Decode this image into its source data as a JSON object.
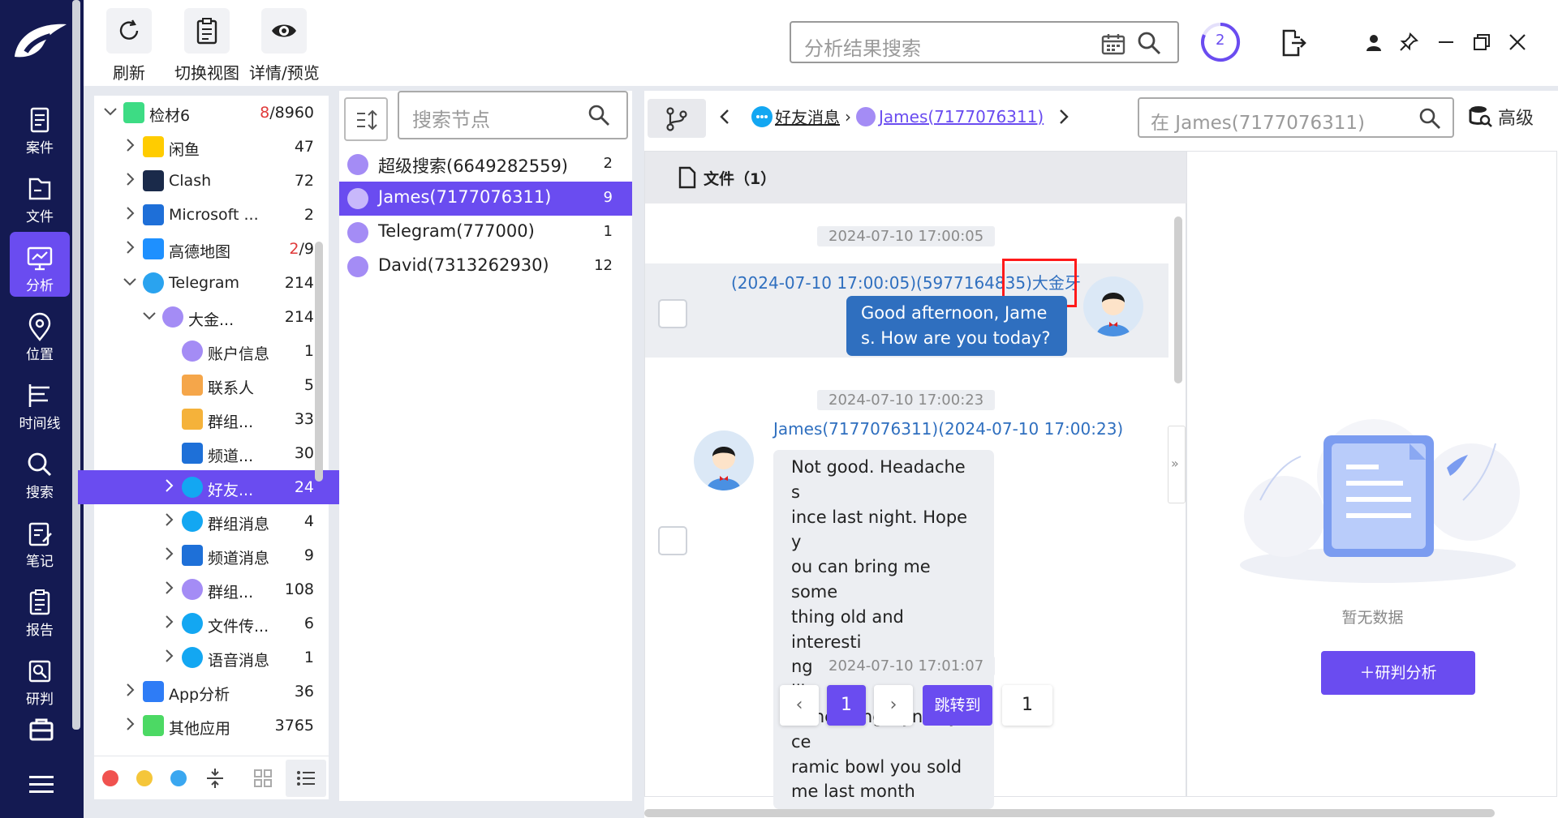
{
  "nav": {
    "items": [
      {
        "label": "案件",
        "icon": "case-icon"
      },
      {
        "label": "文件",
        "icon": "file-icon"
      },
      {
        "label": "分析",
        "icon": "analysis-icon"
      },
      {
        "label": "位置",
        "icon": "location-icon"
      },
      {
        "label": "时间线",
        "icon": "timeline-icon"
      },
      {
        "label": "搜索",
        "icon": "search-icon"
      },
      {
        "label": "笔记",
        "icon": "notes-icon"
      },
      {
        "label": "报告",
        "icon": "report-icon"
      },
      {
        "label": "研判",
        "icon": "judgement-icon"
      }
    ],
    "active": "分析"
  },
  "toolbar": {
    "refresh_label": "刷新",
    "switch_view_label": "切换视图",
    "details_label": "详情/预览",
    "search_placeholder": "分析结果搜索",
    "progress_count": "2"
  },
  "tree": {
    "items": [
      {
        "label": "检材6",
        "count_red": "8",
        "count": "/8960"
      },
      {
        "label": "闲鱼",
        "count": "47"
      },
      {
        "label": "Clash",
        "count": "72"
      },
      {
        "label": "Microsoft ...",
        "count": "2"
      },
      {
        "label": "高德地图",
        "count_red": "2",
        "count": "/9"
      },
      {
        "label": "Telegram",
        "count": "214"
      },
      {
        "label": "大金...",
        "count": "214"
      },
      {
        "label": "账户信息",
        "count": "1"
      },
      {
        "label": "联系人",
        "count": "5"
      },
      {
        "label": "群组...",
        "count": "33"
      },
      {
        "label": "频道...",
        "count": "30"
      },
      {
        "label": "好友...",
        "count": "24"
      },
      {
        "label": "群组消息",
        "count": "4"
      },
      {
        "label": "频道消息",
        "count": "9"
      },
      {
        "label": "群组...",
        "count": "108"
      },
      {
        "label": "文件传...",
        "count": "6"
      },
      {
        "label": "语音消息",
        "count": "1"
      },
      {
        "label": "App分析",
        "count": "36"
      },
      {
        "label": "其他应用",
        "count": "3765"
      }
    ],
    "color_dots": [
      "#f0524f",
      "#f5c63a",
      "#3aa7f0"
    ]
  },
  "nodes": {
    "search_placeholder": "搜索节点",
    "items": [
      {
        "name": "超级搜索(6649282559)",
        "count": "2"
      },
      {
        "name": "James(7177076311)",
        "count": "9"
      },
      {
        "name": "Telegram(777000)",
        "count": "1"
      },
      {
        "name": "David(7313262930)",
        "count": "12"
      }
    ]
  },
  "chat": {
    "breadcrumb_1": "好友消息",
    "breadcrumb_2": "James(7177076311)",
    "search_placeholder": "在 James(7177076311)",
    "advanced_label": "高级",
    "files_tab": "文件（1）",
    "messages": [
      {
        "time": "2024-07-10 17:00:05",
        "header": "(2024-07-10 17:00:05)(5977164835)",
        "sender": "大金牙",
        "lines": [
          "Good afternoon, Jame",
          "s. How are you today?"
        ]
      },
      {
        "time": "2024-07-10 17:00:23",
        "header": "James(7177076311)(2024-07-10 17:00:23)",
        "lines": [
          "Not good. Headache s",
          "ince last night. Hope y",
          "ou can bring me some",
          "thing old and interesti",
          "ng to cheer me up, lik",
          "e the Song Dynasty ce",
          "ramic bowl you sold",
          "me last month"
        ]
      }
    ],
    "next_time": "2024-07-10 17:01:07",
    "pager": {
      "current": "1",
      "jump_label": "跳转到",
      "jump_value": "1"
    }
  },
  "side": {
    "empty_label": "暂无数据",
    "action_label": "＋研判分析"
  },
  "colors": {
    "accent": "#6a4cf0",
    "nav_bg": "#141a52",
    "link": "#2f6fbf",
    "bubble_out": "#2f6fbf",
    "highlight_box": "#ff0000"
  }
}
